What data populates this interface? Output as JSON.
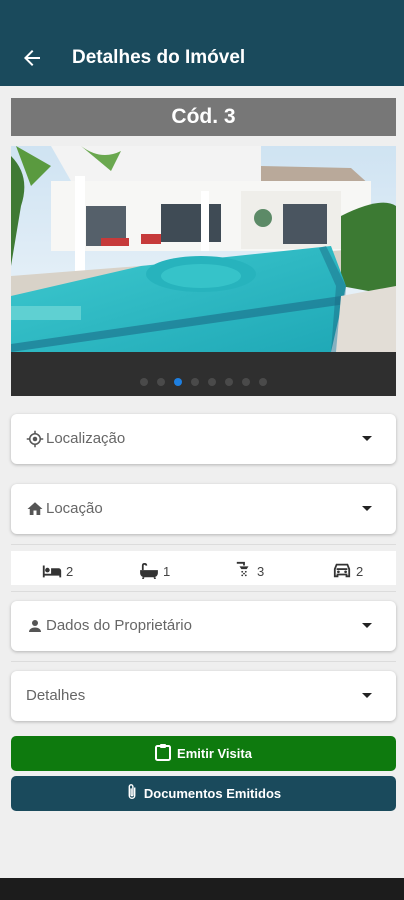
{
  "appbar": {
    "title": "Detalhes do Imóvel",
    "back_icon": "arrow-left-icon"
  },
  "property": {
    "code": "Cód. 3"
  },
  "carousel": {
    "total_slides": 8,
    "active_index": 2,
    "active_color": "#1e7fe0"
  },
  "sections": {
    "location": "Localização",
    "rental": "Locação",
    "owner": "Dados do Proprietário",
    "details": "Detalhes"
  },
  "features": {
    "bedrooms": "2",
    "bathtubs": "1",
    "showers": "3",
    "garage": "2"
  },
  "buttons": {
    "emit_visit": "Emitir Visita",
    "documents": "Documentos Emitidos"
  },
  "colors": {
    "primary": "#1a4a5c",
    "success": "#0e7a0e",
    "code_bar": "#777777"
  }
}
